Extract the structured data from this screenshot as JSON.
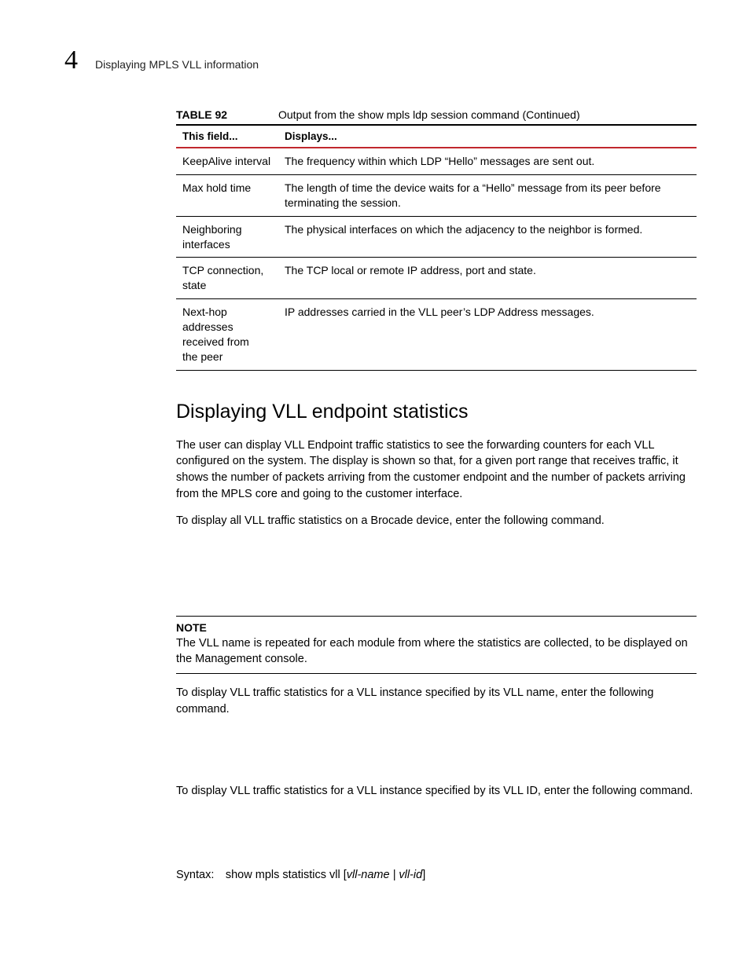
{
  "header": {
    "chapter_number": "4",
    "running_title": "Displaying MPLS VLL information"
  },
  "table": {
    "label": "TABLE 92",
    "caption": "Output from the show mpls ldp session command  (Continued)",
    "head_field": "This field...",
    "head_displays": "Displays...",
    "rows": [
      {
        "field": "KeepAlive interval",
        "displays": "The frequency within which LDP “Hello” messages are sent out."
      },
      {
        "field": "Max hold time",
        "displays": "The length of time the device waits for a “Hello” message from its peer before terminating the session."
      },
      {
        "field": "Neighboring interfaces",
        "displays": "The physical interfaces on which the adjacency to the neighbor is formed."
      },
      {
        "field": "TCP connection, state",
        "displays": "The TCP local or remote IP address, port and state."
      },
      {
        "field": "Next-hop addresses received from the peer",
        "displays": "IP addresses carried in the VLL peer’s LDP Address messages."
      }
    ]
  },
  "section": {
    "title": "Displaying VLL endpoint statistics",
    "p1": "The user can display VLL Endpoint traffic statistics to see the forwarding counters for each VLL configured on the system. The display is shown so that, for a given port range that receives traffic, it shows the number of packets arriving from the customer endpoint and the number of packets arriving from the MPLS core and going to the customer interface.",
    "p2": "To display all VLL traffic statistics on a Brocade device, enter the following command.",
    "note_label": "NOTE",
    "note_body": "The VLL name is repeated for each module from where the statistics are collected, to be displayed on the Management console.",
    "p3": "To display VLL traffic statistics for a VLL instance specified by its VLL name, enter the following command.",
    "p4": "To display VLL traffic statistics for a VLL instance specified by its VLL ID, enter the following command.",
    "syntax_prefix": "Syntax: show mpls statistics vll [",
    "syntax_italics": "vll-name | vll-id",
    "syntax_suffix": "]"
  }
}
